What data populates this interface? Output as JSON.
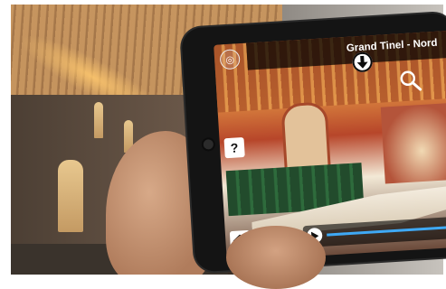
{
  "app": {
    "location_title": "Grand Tinel - Nord"
  },
  "controls": {
    "help_label": "?",
    "compass_icon": "compass-icon",
    "download_icon": "arrow-down-icon",
    "zoom_icon": "magnifier-icon",
    "home_icon": "home-icon",
    "play_icon": "play-icon"
  },
  "player": {
    "progress": 0.97
  },
  "colors": {
    "accent": "#3fa9f5",
    "overlay": "#000000"
  }
}
